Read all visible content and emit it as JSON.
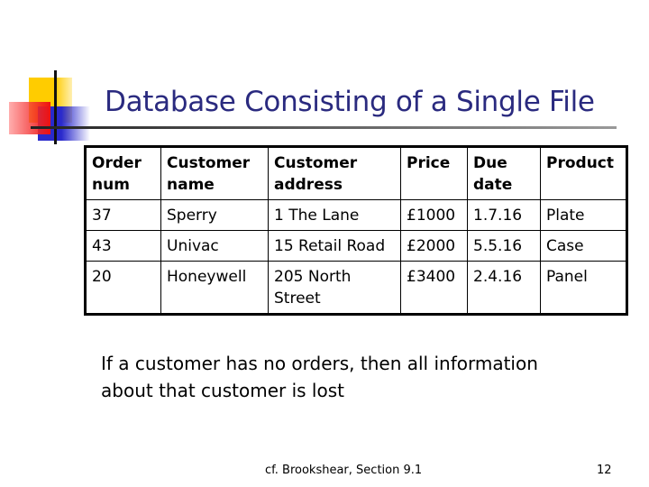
{
  "slide": {
    "title": "Database Consisting of a Single File",
    "table": {
      "headers": [
        "Order num",
        "Customer name",
        "Customer address",
        "Price",
        "Due date",
        "Product"
      ],
      "rows": [
        [
          "37",
          "Sperry",
          "1 The Lane",
          "£1000",
          "1.7.16",
          "Plate"
        ],
        [
          "43",
          "Univac",
          "15 Retail Road",
          "£2000",
          "5.5.16",
          "Case"
        ],
        [
          "20",
          "Honeywell",
          "205 North Street",
          "£3400",
          "2.4.16",
          "Panel"
        ]
      ]
    },
    "note": "If a customer has no orders, then all information about that customer is lost",
    "footer": "cf. Brookshear, Section 9.1",
    "page_number": "12"
  }
}
